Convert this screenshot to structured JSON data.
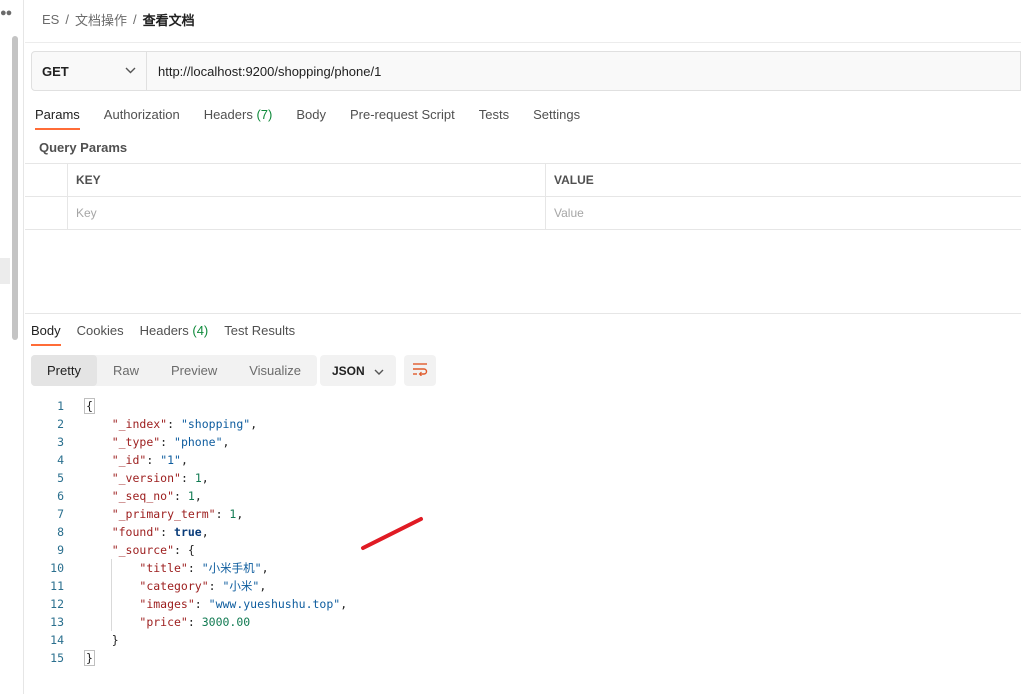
{
  "breadcrumb": {
    "items": [
      "ES",
      "文档操作"
    ],
    "current": "查看文档",
    "separator": "/"
  },
  "request": {
    "method": "GET",
    "url": "http://localhost:9200/shopping/phone/1"
  },
  "tabs": [
    {
      "label": "Params",
      "active": true
    },
    {
      "label": "Authorization"
    },
    {
      "label": "Headers",
      "count": "(7)"
    },
    {
      "label": "Body"
    },
    {
      "label": "Pre-request Script"
    },
    {
      "label": "Tests"
    },
    {
      "label": "Settings"
    }
  ],
  "query_params": {
    "title": "Query Params",
    "key_header": "KEY",
    "value_header": "VALUE",
    "key_placeholder": "Key",
    "value_placeholder": "Value"
  },
  "response": {
    "tabs": [
      {
        "label": "Body",
        "active": true
      },
      {
        "label": "Cookies"
      },
      {
        "label": "Headers",
        "count": "(4)"
      },
      {
        "label": "Test Results"
      }
    ],
    "views": [
      "Pretty",
      "Raw",
      "Preview",
      "Visualize"
    ],
    "active_view": "Pretty",
    "format": "JSON"
  },
  "code_lines": [
    {
      "n": "1",
      "t": [
        [
          "p",
          "{"
        ]
      ],
      "box": true
    },
    {
      "n": "2",
      "t": [
        [
          "p",
          "    "
        ],
        [
          "k",
          "\"_index\""
        ],
        [
          "p",
          ": "
        ],
        [
          "s",
          "\"shopping\""
        ],
        [
          "p",
          ","
        ]
      ]
    },
    {
      "n": "3",
      "t": [
        [
          "p",
          "    "
        ],
        [
          "k",
          "\"_type\""
        ],
        [
          "p",
          ": "
        ],
        [
          "s",
          "\"phone\""
        ],
        [
          "p",
          ","
        ]
      ]
    },
    {
      "n": "4",
      "t": [
        [
          "p",
          "    "
        ],
        [
          "k",
          "\"_id\""
        ],
        [
          "p",
          ": "
        ],
        [
          "s",
          "\"1\""
        ],
        [
          "p",
          ","
        ]
      ]
    },
    {
      "n": "5",
      "t": [
        [
          "p",
          "    "
        ],
        [
          "k",
          "\"_version\""
        ],
        [
          "p",
          ": "
        ],
        [
          "n",
          "1"
        ],
        [
          "p",
          ","
        ]
      ]
    },
    {
      "n": "6",
      "t": [
        [
          "p",
          "    "
        ],
        [
          "k",
          "\"_seq_no\""
        ],
        [
          "p",
          ": "
        ],
        [
          "n",
          "1"
        ],
        [
          "p",
          ","
        ]
      ]
    },
    {
      "n": "7",
      "t": [
        [
          "p",
          "    "
        ],
        [
          "k",
          "\"_primary_term\""
        ],
        [
          "p",
          ": "
        ],
        [
          "n",
          "1"
        ],
        [
          "p",
          ","
        ]
      ]
    },
    {
      "n": "8",
      "t": [
        [
          "p",
          "    "
        ],
        [
          "k",
          "\"found\""
        ],
        [
          "p",
          ": "
        ],
        [
          "b",
          "true"
        ],
        [
          "p",
          ","
        ]
      ]
    },
    {
      "n": "9",
      "t": [
        [
          "p",
          "    "
        ],
        [
          "k",
          "\"_source\""
        ],
        [
          "p",
          ": {"
        ]
      ]
    },
    {
      "n": "10",
      "t": [
        [
          "p",
          "        "
        ],
        [
          "k",
          "\"title\""
        ],
        [
          "p",
          ": "
        ],
        [
          "s",
          "\"小米手机\""
        ],
        [
          "p",
          ","
        ]
      ]
    },
    {
      "n": "11",
      "t": [
        [
          "p",
          "        "
        ],
        [
          "k",
          "\"category\""
        ],
        [
          "p",
          ": "
        ],
        [
          "s",
          "\"小米\""
        ],
        [
          "p",
          ","
        ]
      ]
    },
    {
      "n": "12",
      "t": [
        [
          "p",
          "        "
        ],
        [
          "k",
          "\"images\""
        ],
        [
          "p",
          ": "
        ],
        [
          "s",
          "\"www.yueshushu.top\""
        ],
        [
          "p",
          ","
        ]
      ]
    },
    {
      "n": "13",
      "t": [
        [
          "p",
          "        "
        ],
        [
          "k",
          "\"price\""
        ],
        [
          "p",
          ": "
        ],
        [
          "n",
          "3000.00"
        ]
      ]
    },
    {
      "n": "14",
      "t": [
        [
          "p",
          "    }"
        ]
      ]
    },
    {
      "n": "15",
      "t": [
        [
          "p",
          "}"
        ]
      ],
      "box": true
    }
  ],
  "colors": {
    "accent": "#ff6c37",
    "count_green": "#0f8a3b",
    "annotation_red": "#e01b24"
  }
}
